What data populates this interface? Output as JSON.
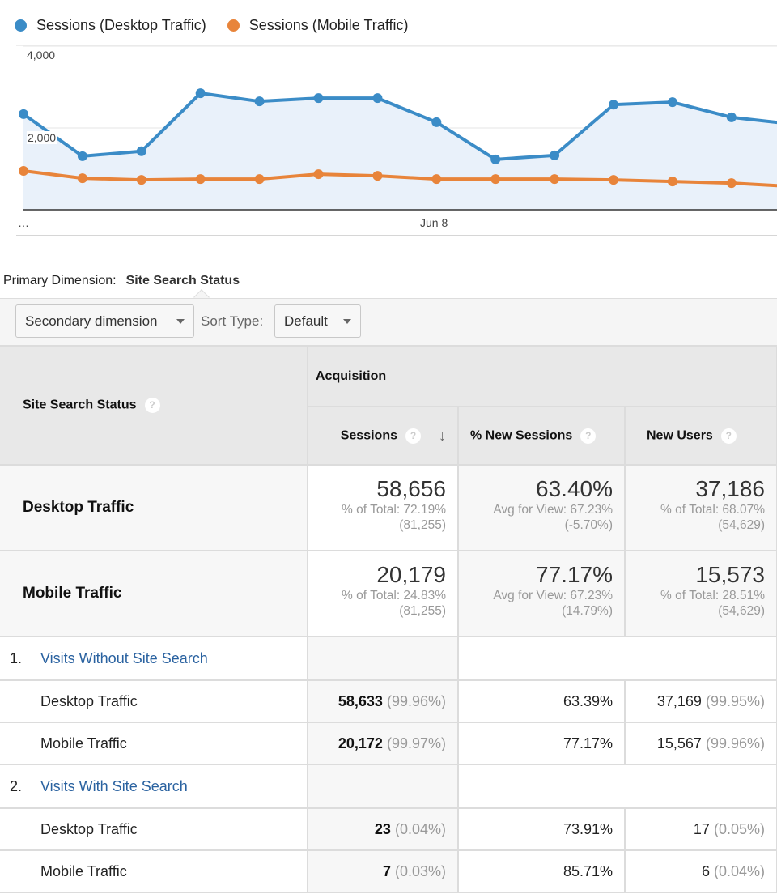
{
  "legend": [
    {
      "label": "Sessions (Desktop Traffic)",
      "color": "#3b8cc7"
    },
    {
      "label": "Sessions (Mobile Traffic)",
      "color": "#e8843a"
    }
  ],
  "chart_data": {
    "type": "line",
    "title": "",
    "xlabel": "",
    "ylabel": "Sessions",
    "x_tick_labels": [
      "…",
      "Jun 8"
    ],
    "y_tick_labels": [
      "2,000",
      "4,000"
    ],
    "y_ticks": [
      2000,
      4000
    ],
    "ylim": [
      0,
      4000
    ],
    "grid": true,
    "legend_position": "top-left",
    "x": [
      1,
      2,
      3,
      4,
      5,
      6,
      7,
      8,
      9,
      10,
      11,
      12,
      13,
      14
    ],
    "x_label_index": {
      "…": 0,
      "Jun 8": 7
    },
    "series": [
      {
        "name": "Sessions (Desktop Traffic)",
        "color": "#3b8cc7",
        "area": true,
        "values": [
          2340,
          1310,
          1430,
          2850,
          2650,
          2730,
          2730,
          2140,
          1230,
          1330,
          2570,
          2630,
          2260,
          2100
        ]
      },
      {
        "name": "Sessions (Mobile Traffic)",
        "color": "#e8843a",
        "area": false,
        "values": [
          950,
          770,
          730,
          750,
          750,
          870,
          830,
          750,
          750,
          750,
          730,
          690,
          650,
          570
        ]
      }
    ]
  },
  "primary_dimension": {
    "label": "Primary Dimension:",
    "value": "Site Search Status"
  },
  "toolbar": {
    "secondary_dimension_label": "Secondary dimension",
    "sort_type_label": "Sort Type:",
    "sort_type_value": "Default"
  },
  "table": {
    "dimension_header": "Site Search Status",
    "group_header": "Acquisition",
    "columns": [
      {
        "label": "Sessions",
        "sorted": true,
        "sort_direction": "descending"
      },
      {
        "label": "% New Sessions",
        "sorted": false
      },
      {
        "label": "New Users",
        "sorted": false
      }
    ],
    "summary_rows": [
      {
        "label": "Desktop Traffic",
        "cells": [
          {
            "value": "58,656",
            "sub1": "% of Total: 72.19%",
            "sub2": "(81,255)"
          },
          {
            "value": "63.40%",
            "sub1": "Avg for View: 67.23%",
            "sub2": "(-5.70%)"
          },
          {
            "value": "37,186",
            "sub1": "% of Total: 68.07%",
            "sub2": "(54,629)"
          }
        ]
      },
      {
        "label": "Mobile Traffic",
        "cells": [
          {
            "value": "20,179",
            "sub1": "% of Total: 24.83%",
            "sub2": "(81,255)"
          },
          {
            "value": "77.17%",
            "sub1": "Avg for View: 67.23%",
            "sub2": "(14.79%)"
          },
          {
            "value": "15,573",
            "sub1": "% of Total: 28.51%",
            "sub2": "(54,629)"
          }
        ]
      }
    ],
    "groups": [
      {
        "index": "1.",
        "label": "Visits Without Site Search",
        "rows": [
          {
            "label": "Desktop Traffic",
            "sessions": "58,633",
            "sessions_pct": "(99.96%)",
            "new_sessions": "63.39%",
            "new_users": "37,169",
            "new_users_pct": "(99.95%)"
          },
          {
            "label": "Mobile Traffic",
            "sessions": "20,172",
            "sessions_pct": "(99.97%)",
            "new_sessions": "77.17%",
            "new_users": "15,567",
            "new_users_pct": "(99.96%)"
          }
        ]
      },
      {
        "index": "2.",
        "label": "Visits With Site Search",
        "rows": [
          {
            "label": "Desktop Traffic",
            "sessions": "23",
            "sessions_pct": "(0.04%)",
            "new_sessions": "73.91%",
            "new_users": "17",
            "new_users_pct": "(0.05%)"
          },
          {
            "label": "Mobile Traffic",
            "sessions": "7",
            "sessions_pct": "(0.03%)",
            "new_sessions": "85.71%",
            "new_users": "6",
            "new_users_pct": "(0.04%)"
          }
        ]
      }
    ]
  }
}
